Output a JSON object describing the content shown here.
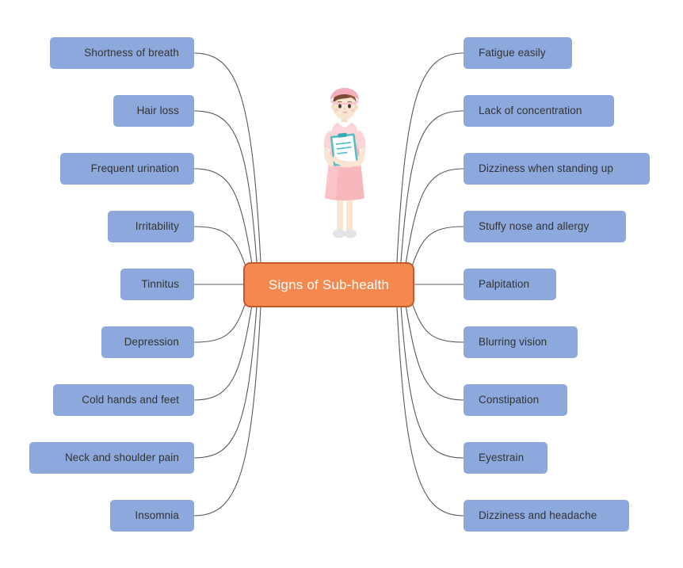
{
  "diagram": {
    "type": "mind-map",
    "center": {
      "label": "Signs of Sub-health",
      "fill": "#f5884e",
      "border": "#c4592a",
      "text_color": "#ffffff"
    },
    "node_style": {
      "fill": "#8ca8dc",
      "text_color": "#333333"
    },
    "connector_color": "#59595b",
    "background": "#ffffff",
    "left_branches": [
      {
        "label": "Shortness of breath"
      },
      {
        "label": "Hair loss"
      },
      {
        "label": "Frequent urination"
      },
      {
        "label": "Irritability"
      },
      {
        "label": "Tinnitus"
      },
      {
        "label": "Depression"
      },
      {
        "label": "Cold hands and feet"
      },
      {
        "label": "Neck and shoulder pain"
      },
      {
        "label": "Insomnia"
      }
    ],
    "right_branches": [
      {
        "label": "Fatigue easily"
      },
      {
        "label": "Lack of concentration"
      },
      {
        "label": "Dizziness when standing up"
      },
      {
        "label": "Stuffy nose and allergy"
      },
      {
        "label": "Palpitation"
      },
      {
        "label": "Blurring vision"
      },
      {
        "label": "Constipation"
      },
      {
        "label": "Eyestrain"
      },
      {
        "label": "Dizziness and headache"
      }
    ],
    "illustration": {
      "name": "nurse-illustration",
      "description": "Nurse holding a clipboard",
      "colors": {
        "uniform": "#f7b8bd",
        "uniform_light": "#fbd5d8",
        "skin": "#f7e2cb",
        "hair": "#7b4b36",
        "cap": "#f4aebb",
        "clipboard_border": "#4fc0c8",
        "clipboard_paper": "#ffffff",
        "shoes": "#e2e2e2"
      }
    }
  }
}
